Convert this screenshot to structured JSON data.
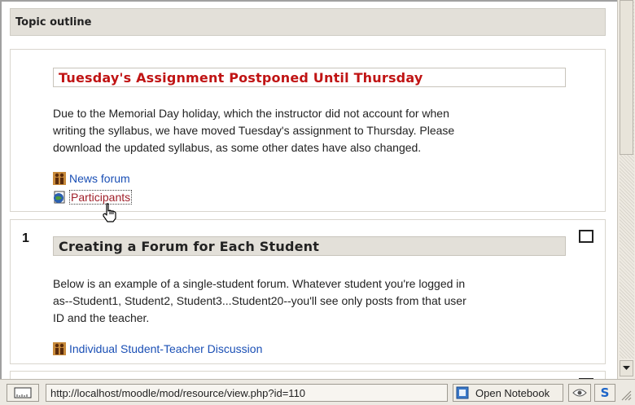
{
  "topic_outline": {
    "title": "Topic outline"
  },
  "section0": {
    "title": "Tuesday's Assignment Postponed Until Thursday",
    "summary_lines": [
      "Due to the Memorial Day holiday, which the instructor did not account for when",
      "writing the syllabus, we have moved Tuesday's assignment to Thursday. Please",
      "download the updated syllabus, as some other dates have also changed."
    ],
    "activities": [
      {
        "label": "News forum",
        "icon": "forum-icon"
      },
      {
        "label": "Participants",
        "icon": "globe-icon"
      }
    ]
  },
  "section1": {
    "number": "1",
    "title": "Creating a Forum for Each Student",
    "summary_lines": [
      "Below is an example of a single-student forum. Whatever student you're logged in",
      "as--Student1, Student2, Student3...Student20--you'll see only posts from that user",
      "ID and the teacher."
    ],
    "activities": [
      {
        "label": "Individual Student-Teacher Discussion",
        "icon": "forum-icon"
      }
    ]
  },
  "statusbar": {
    "url": "http://localhost/moodle/mod/resource/view.php?id=110",
    "notebook_label": "Open Notebook",
    "s_label": "S"
  },
  "colors": {
    "link": "#1a4fb5",
    "heading_red": "#c01414",
    "header_bg": "#e3e0d9"
  }
}
